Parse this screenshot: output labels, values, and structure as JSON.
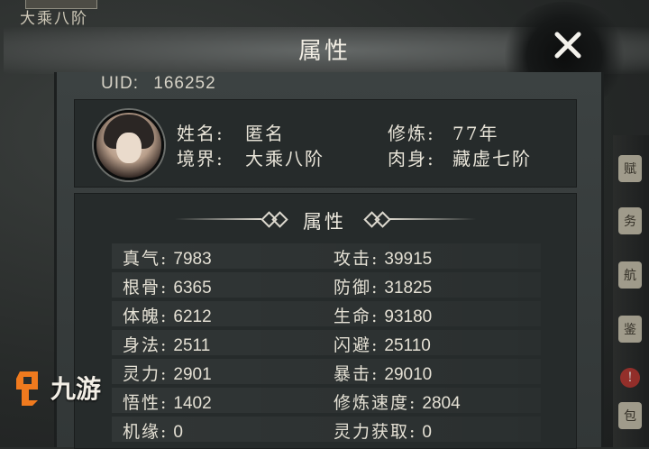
{
  "background": {
    "top_left_text": "大乘八阶",
    "side_items": [
      "赋",
      "务",
      "航",
      "鉴",
      "!",
      "包"
    ]
  },
  "panel": {
    "title": "属性",
    "close_icon": "close-icon"
  },
  "player": {
    "uid_label": "UID:",
    "uid_value": "166252",
    "name_label": "姓名:",
    "name_value": "匿名",
    "realm_label": "境界:",
    "realm_value": "大乘八阶",
    "cultivation_label": "修炼:",
    "cultivation_value": "77年",
    "body_label": "肉身:",
    "body_value": "藏虚七阶"
  },
  "stats": {
    "header": "属性",
    "left": [
      {
        "label": "真气:",
        "value": "7983"
      },
      {
        "label": "根骨:",
        "value": "6365"
      },
      {
        "label": "体魄:",
        "value": "6212"
      },
      {
        "label": "身法:",
        "value": "2511"
      },
      {
        "label": "灵力:",
        "value": "2901"
      },
      {
        "label": "悟性:",
        "value": "1402"
      },
      {
        "label": "机缘:",
        "value": "0"
      }
    ],
    "right": [
      {
        "label": "攻击:",
        "value": "39915"
      },
      {
        "label": "防御:",
        "value": "31825"
      },
      {
        "label": "生命:",
        "value": "93180"
      },
      {
        "label": "闪避:",
        "value": "25110"
      },
      {
        "label": "暴击:",
        "value": "29010"
      },
      {
        "label": "修炼速度:",
        "value": "2804"
      },
      {
        "label": "灵力获取:",
        "value": "0"
      }
    ]
  },
  "watermark": {
    "text": "九游",
    "accent": "#f07a1e"
  }
}
